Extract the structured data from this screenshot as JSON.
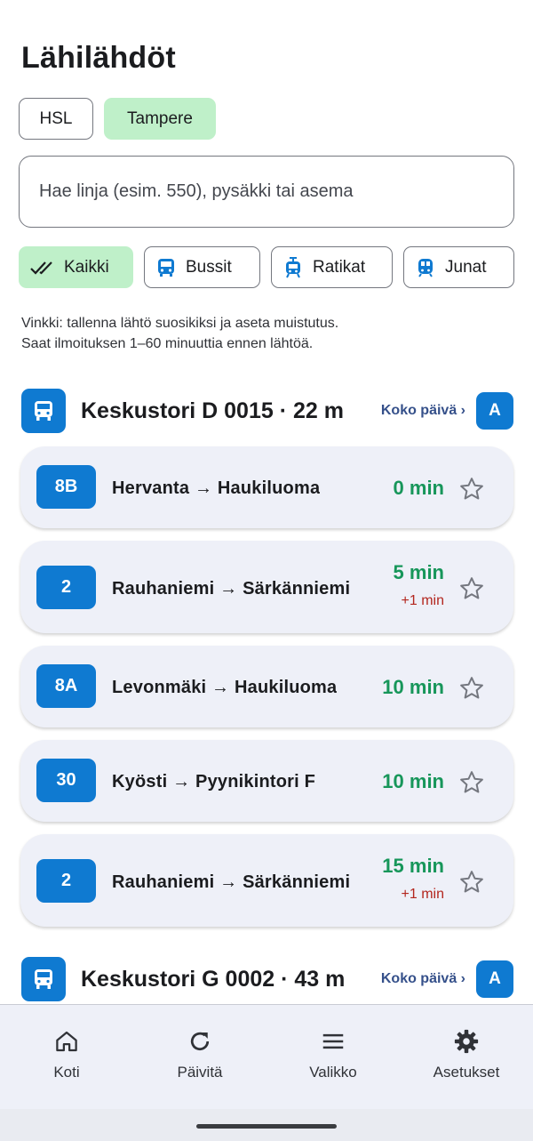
{
  "page": {
    "title": "Lähilähdöt"
  },
  "regions": [
    {
      "label": "HSL",
      "selected": false
    },
    {
      "label": "Tampere",
      "selected": true
    }
  ],
  "search": {
    "placeholder": "Hae linja (esim. 550), pysäkki tai asema"
  },
  "filters": [
    {
      "label": "Kaikki",
      "icon": "double-check-icon",
      "selected": true
    },
    {
      "label": "Bussit",
      "icon": "bus-icon",
      "selected": false
    },
    {
      "label": "Ratikat",
      "icon": "tram-icon",
      "selected": false
    },
    {
      "label": "Junat",
      "icon": "train-icon",
      "selected": false
    }
  ],
  "hint": {
    "line1": "Vinkki: tallenna lähtö suosikiksi ja aseta muistutus.",
    "line2": "Saat ilmoituksen 1–60 minuuttia ennen lähtöä."
  },
  "stops": [
    {
      "name": "Keskustori D 0015 · 22 m",
      "whole_day": "Koko päivä ›",
      "badge": "A",
      "departures": [
        {
          "line": "8B",
          "route": "Hervanta → Haukiluoma",
          "minutes": "0 min",
          "delay": ""
        },
        {
          "line": "2",
          "route": "Rauhaniemi → Särkänniemi",
          "minutes": "5 min",
          "delay": "+1 min"
        },
        {
          "line": "8A",
          "route": "Levonmäki → Haukiluoma",
          "minutes": "10 min",
          "delay": ""
        },
        {
          "line": "30",
          "route": "Kyösti → Pyynikintori F",
          "minutes": "10 min",
          "delay": ""
        },
        {
          "line": "2",
          "route": "Rauhaniemi → Särkänniemi",
          "minutes": "15 min",
          "delay": "+1 min"
        }
      ]
    },
    {
      "name": "Keskustori G 0002 · 43 m",
      "whole_day": "Koko päivä ›",
      "badge": "A"
    }
  ],
  "bottom_nav": [
    {
      "label": "Koti",
      "icon": "home-icon"
    },
    {
      "label": "Päivitä",
      "icon": "refresh-icon"
    },
    {
      "label": "Valikko",
      "icon": "menu-icon"
    },
    {
      "label": "Asetukset",
      "icon": "settings-icon"
    }
  ],
  "colors": {
    "accent": "#0f7ad1",
    "selected_chip": "#bff0c9",
    "minutes_green": "#17965a",
    "delay_red": "#b3261e",
    "card_bg": "#eef0f8"
  }
}
